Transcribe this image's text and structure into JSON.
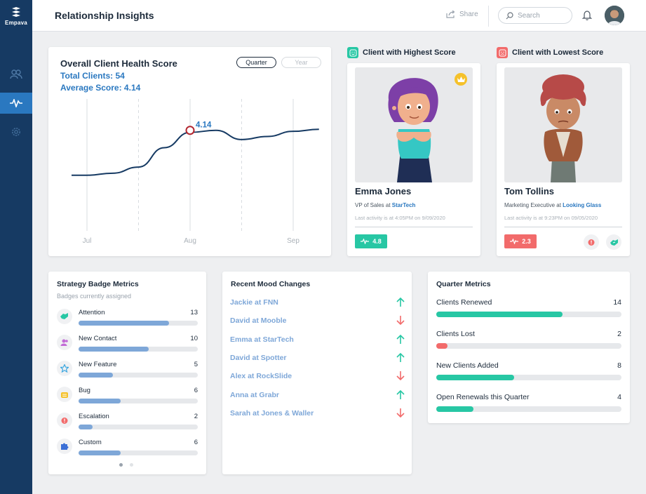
{
  "app": {
    "logo_text": "Empava",
    "title": "Relationship Insights"
  },
  "header": {
    "share_label": "Share",
    "search_placeholder": "Search"
  },
  "health": {
    "title": "Overall Client Health Score",
    "total_clients": "Total Clients: 54",
    "average_score": "Average Score: 4.14",
    "toggle_quarter": "Quarter",
    "toggle_year": "Year",
    "point_label": "4.14"
  },
  "chart_data": {
    "type": "line",
    "categories": [
      "Jul",
      "Aug",
      "Sep"
    ],
    "x": [
      0,
      0.25,
      0.5,
      0.75,
      1.0,
      1.25,
      1.5,
      1.75,
      2.0,
      2.25
    ],
    "values": [
      3.7,
      3.72,
      3.78,
      3.97,
      4.12,
      4.14,
      4.05,
      4.08,
      4.13,
      4.15
    ],
    "highlight": {
      "x": 1.0,
      "y": 4.14,
      "label": "4.14"
    },
    "series_color": "#163a63"
  },
  "high_client": {
    "heading": "Client with Highest Score",
    "name": "Emma Jones",
    "role_prefix": "VP of Sales at ",
    "company": "StarTech",
    "activity": "Last activity is at 4:05PM on 9/09/2020",
    "score": "4.8",
    "color": "#27c7a4"
  },
  "low_client": {
    "heading": "Client with Lowest Score",
    "name": "Tom Tollins",
    "role_prefix": "Marketing Executive at ",
    "company": "Looking Glass",
    "activity": "Last activity is at 9:23PM on 09/05/2020",
    "score": "2.3",
    "color": "#f26b6b"
  },
  "strategy": {
    "title": "Strategy Badge Metrics",
    "subtitle": "Badges currently assigned",
    "max": 17,
    "items": [
      {
        "label": "Attention",
        "count": "13",
        "value": 13,
        "icon": "handshake-icon"
      },
      {
        "label": "New Contact",
        "count": "10",
        "value": 10,
        "icon": "contact-icon"
      },
      {
        "label": "New Feature",
        "count": "5",
        "value": 5,
        "icon": "star-icon"
      },
      {
        "label": "Bug",
        "count": "6",
        "value": 6,
        "icon": "bug-icon"
      },
      {
        "label": "Escalation",
        "count": "2",
        "value": 2,
        "icon": "alarm-icon"
      },
      {
        "label": "Custom",
        "count": "6",
        "value": 6,
        "icon": "puzzle-icon"
      }
    ]
  },
  "mood": {
    "title": "Recent Mood Changes",
    "items": [
      {
        "label": "Jackie at FNN",
        "direction": "up"
      },
      {
        "label": "David at Mooble",
        "direction": "down"
      },
      {
        "label": "Emma at StarTech",
        "direction": "up"
      },
      {
        "label": "David at Spotter",
        "direction": "up"
      },
      {
        "label": "Alex at RockSlide",
        "direction": "down"
      },
      {
        "label": "Anna at Grabr",
        "direction": "up"
      },
      {
        "label": "Sarah at Jones & Waller",
        "direction": "down"
      }
    ]
  },
  "quarter": {
    "title": "Quarter Metrics",
    "items": [
      {
        "label": "Clients Renewed",
        "value": "14",
        "fraction": 0.68,
        "color": "#27c7a4"
      },
      {
        "label": "Clients Lost",
        "value": "2",
        "fraction": 0.06,
        "color": "#f26b6b"
      },
      {
        "label": "New Clients Added",
        "value": "8",
        "fraction": 0.42,
        "color": "#27c7a4"
      },
      {
        "label": "Open Renewals this Quarter",
        "value": "4",
        "fraction": 0.2,
        "color": "#27c7a4"
      }
    ]
  }
}
